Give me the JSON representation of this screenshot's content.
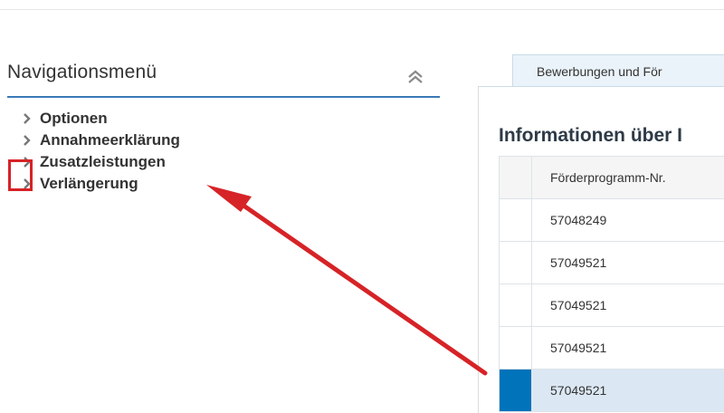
{
  "navigation": {
    "title": "Navigationsmenü",
    "collapse_icon": "double-chevron-up-icon",
    "items": [
      {
        "label": "Optionen",
        "icon": "chevron-right-icon"
      },
      {
        "label": "Annahmeerklärung",
        "icon": "chevron-right-icon"
      },
      {
        "label": "Zusatzleistungen",
        "icon": "chevron-right-icon"
      },
      {
        "label": "Verlängerung",
        "icon": "chevron-right-icon"
      }
    ]
  },
  "tab": {
    "label": "Bewerbungen und För"
  },
  "main": {
    "section_title": "Informationen über I",
    "table": {
      "column_header": "Förderprogramm-Nr.",
      "rows": [
        {
          "value": "57048249",
          "selected": false
        },
        {
          "value": "57049521",
          "selected": false
        },
        {
          "value": "57049521",
          "selected": false
        },
        {
          "value": "57049521",
          "selected": false
        },
        {
          "value": "57049521",
          "selected": true
        }
      ]
    }
  },
  "annotation": {
    "highlight_color": "#d62327",
    "arrow_color": "#d62327"
  },
  "colors": {
    "accent": "#3a79b8",
    "selected_row": "#0073bb",
    "tab_background": "#eaf3f9"
  }
}
